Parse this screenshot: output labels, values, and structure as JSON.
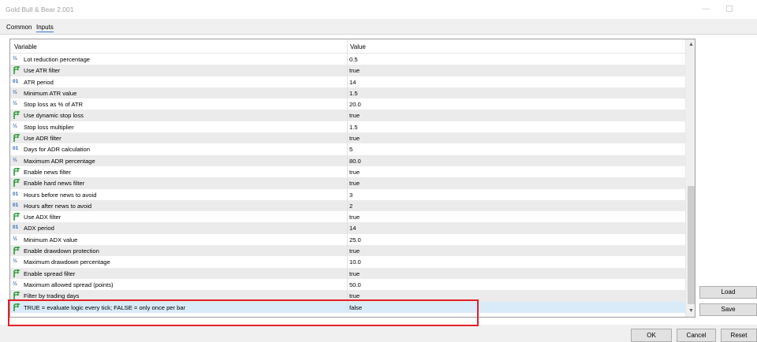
{
  "window": {
    "title": "Gold Bull & Bear 2.001",
    "minimize_glyph": "—",
    "maximize_glyph": ""
  },
  "tabs": [
    {
      "label": "Common",
      "active": false
    },
    {
      "label": "Inputs",
      "active": true
    }
  ],
  "grid": {
    "columns": {
      "variable": "Variable",
      "value": "Value"
    },
    "rows": [
      {
        "icon": "double-icon",
        "name": "Lot reduction percentage",
        "value": "0.5"
      },
      {
        "icon": "bool-icon",
        "name": "Use ATR filter",
        "value": "true"
      },
      {
        "icon": "int-icon",
        "name": "ATR period",
        "value": "14"
      },
      {
        "icon": "double-icon",
        "name": "Minimum ATR value",
        "value": "1.5"
      },
      {
        "icon": "double-icon",
        "name": "Stop loss as % of ATR",
        "value": "20.0"
      },
      {
        "icon": "bool-icon",
        "name": "Use dynamic stop loss",
        "value": "true"
      },
      {
        "icon": "double-icon",
        "name": "Stop loss multiplier",
        "value": "1.5"
      },
      {
        "icon": "bool-icon",
        "name": "Use ADR filter",
        "value": "true"
      },
      {
        "icon": "int-icon",
        "name": "Days for ADR calculation",
        "value": "5"
      },
      {
        "icon": "double-icon",
        "name": "Maximum ADR percentage",
        "value": "80.0"
      },
      {
        "icon": "bool-icon",
        "name": "Enable news filter",
        "value": "true"
      },
      {
        "icon": "bool-icon",
        "name": "Enable hard news filter",
        "value": "true"
      },
      {
        "icon": "int-icon",
        "name": "Hours before news to avoid",
        "value": "3"
      },
      {
        "icon": "int-icon",
        "name": "Hours after news to avoid",
        "value": "2"
      },
      {
        "icon": "bool-icon",
        "name": "Use ADX filter",
        "value": "true"
      },
      {
        "icon": "int-icon",
        "name": "ADX period",
        "value": "14"
      },
      {
        "icon": "double-icon",
        "name": "Minimum ADX value",
        "value": "25.0"
      },
      {
        "icon": "bool-icon",
        "name": "Enable drawdown protection",
        "value": "true"
      },
      {
        "icon": "double-icon",
        "name": "Maximum drawdown percentage",
        "value": "10.0"
      },
      {
        "icon": "bool-icon",
        "name": "Enable spread filter",
        "value": "true"
      },
      {
        "icon": "double-icon",
        "name": "Maximum allowed spread (points)",
        "value": "50.0"
      },
      {
        "icon": "bool-icon",
        "name": "Filter by trading days",
        "value": "true"
      },
      {
        "icon": "bool-icon",
        "name": "TRUE = evaluate logic every tick; FALSE = only once per bar",
        "value": "false",
        "selected": true
      }
    ],
    "icon_glyphs": {
      "double": "½",
      "int": "01"
    }
  },
  "side_buttons": {
    "load": "Load",
    "save": "Save"
  },
  "footer_buttons": {
    "ok": "OK",
    "cancel": "Cancel",
    "reset": "Reset"
  },
  "colors": {
    "highlight": "#e0202a",
    "selected_row": "#d9ebf9",
    "bool_icon": "#2f9a3e"
  }
}
